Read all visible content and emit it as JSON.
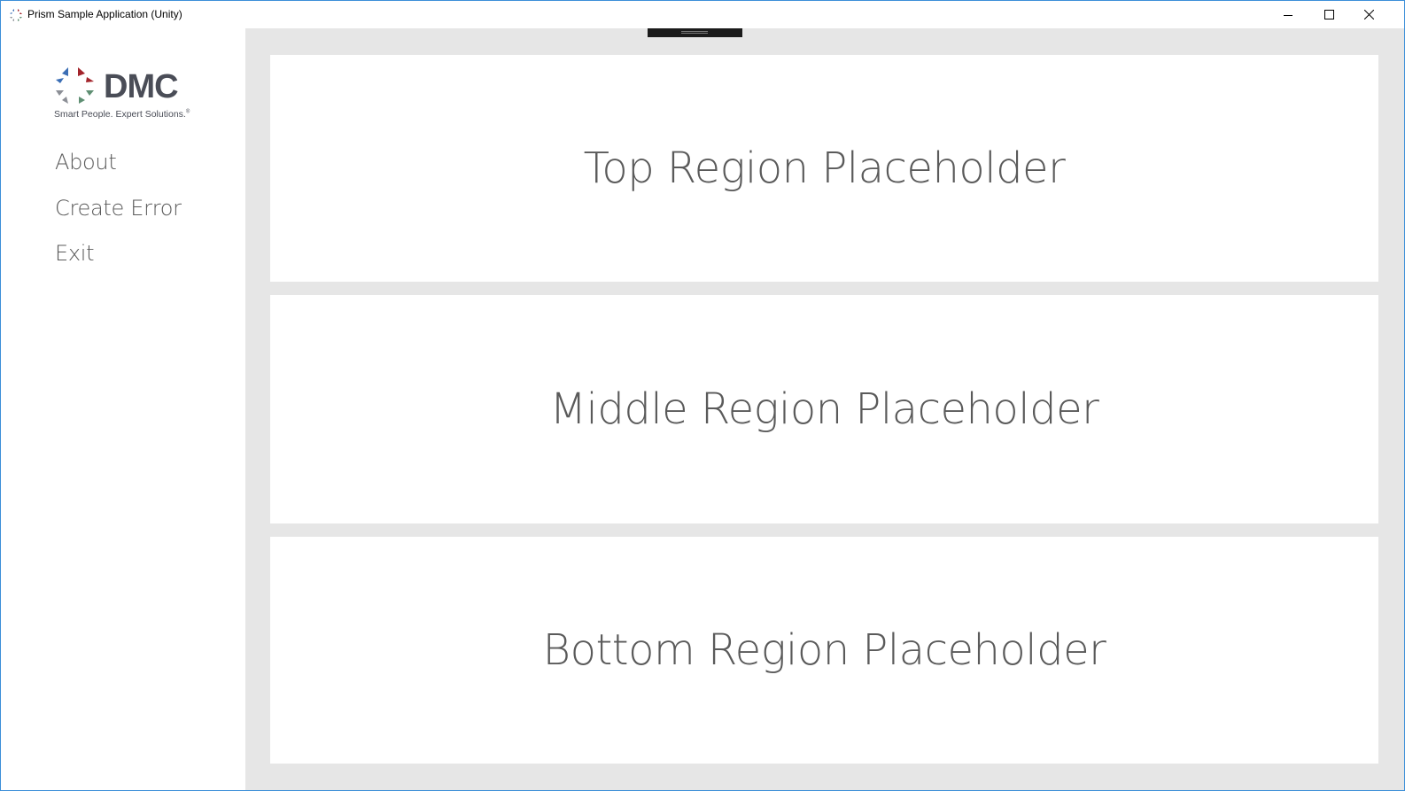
{
  "window": {
    "title": "Prism Sample Application (Unity)",
    "controls": {
      "minimize": "minimize-icon",
      "maximize": "maximize-icon",
      "close": "close-icon"
    },
    "border_color": "#3c8fd8"
  },
  "sidebar": {
    "logo": {
      "text": "DMC",
      "tagline": "Smart People. Expert Solutions.",
      "tagline_mark": "®",
      "colors": {
        "blue": "#3b6eb5",
        "red": "#a3242b",
        "gray": "#8c8f96",
        "green": "#5f8f73",
        "text": "#4a4d57"
      }
    },
    "nav": [
      {
        "label": "About"
      },
      {
        "label": "Create Error"
      },
      {
        "label": "Exit"
      }
    ]
  },
  "content": {
    "regions": [
      {
        "label": "Top Region Placeholder"
      },
      {
        "label": "Middle Region Placeholder"
      },
      {
        "label": "Bottom Region Placeholder"
      }
    ],
    "background": "#e6e6e6",
    "text_color": "#5a5a5a"
  }
}
